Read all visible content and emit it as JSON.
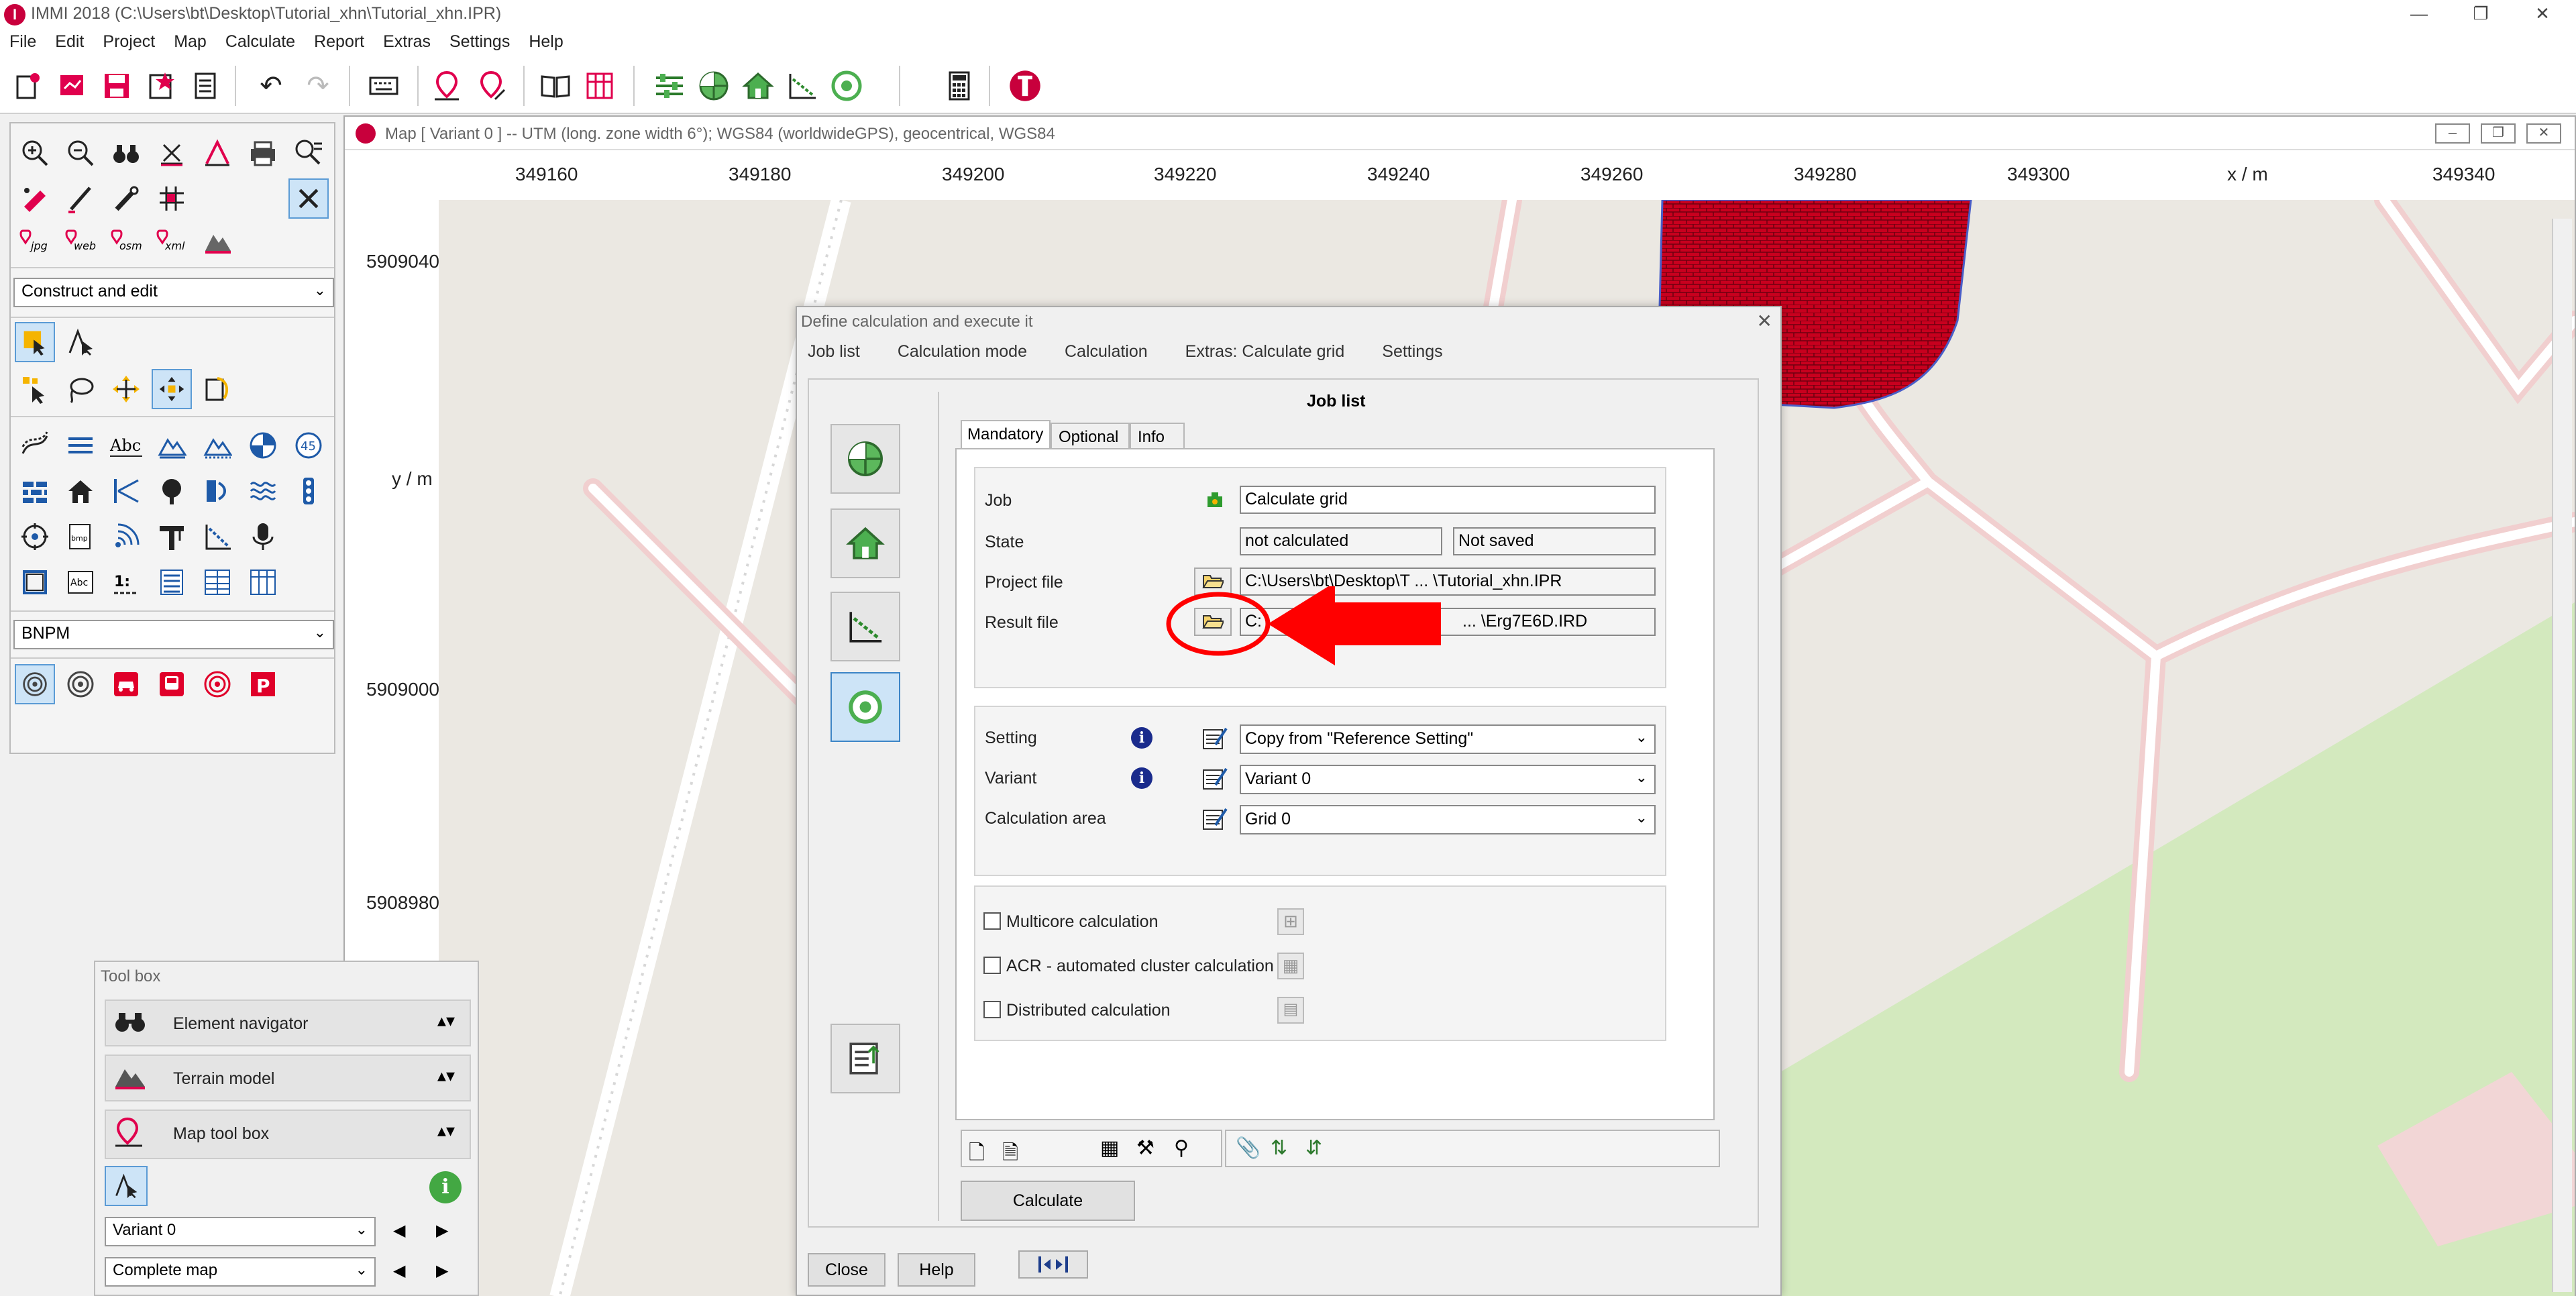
{
  "app": {
    "title": "IMMI 2018 (C:\\Users\\bt\\Desktop\\Tutorial_xhn\\Tutorial_xhn.IPR)",
    "logo_letter": "I"
  },
  "window_controls": {
    "minimize": "—",
    "restore": "❐",
    "close": "✕"
  },
  "menubar": [
    "File",
    "Edit",
    "Project",
    "Map",
    "Calculate",
    "Report",
    "Extras",
    "Settings",
    "Help"
  ],
  "left_panel": {
    "mode_select": "Construct and edit",
    "layer_select": "BNPM"
  },
  "map_window": {
    "title": "Map  [ Variant 0 ]  --  UTM (long. zone width 6°); WGS84 (worldwideGPS), geocentrical, WGS84",
    "x_ticks": [
      "349160",
      "349180",
      "349200",
      "349220",
      "349240",
      "349260",
      "349280",
      "349300",
      "x / m",
      "349340"
    ],
    "y_ticks": [
      "5909040",
      "y / m",
      "5909000",
      "5908980"
    ]
  },
  "dialog": {
    "title": "Define calculation and execute it",
    "menu": [
      "Job list",
      "Calculation mode",
      "Calculation",
      "Extras: Calculate grid",
      "Settings"
    ],
    "heading": "Job list",
    "tabs": [
      "Mandatory",
      "Optional",
      "Info"
    ],
    "fields": {
      "job_label": "Job",
      "job_value": "Calculate grid",
      "state_label": "State",
      "state_value1": "not calculated",
      "state_value2": "Not saved",
      "project_label": "Project file",
      "project_value": "C:\\Users\\bt\\Desktop\\T ... \\Tutorial_xhn.IPR",
      "result_label": "Result file",
      "result_value_start": "C:",
      "result_value_end": "... \\Erg7E6D.IRD"
    },
    "settings": {
      "setting_label": "Setting",
      "setting_value": "Copy from \"Reference Setting\"",
      "variant_label": "Variant",
      "variant_value": "Variant 0",
      "area_label": "Calculation area",
      "area_value": "Grid 0"
    },
    "options": {
      "multicore": "Multicore calculation",
      "acr": "ACR - automated cluster calculation",
      "distributed": "Distributed calculation"
    },
    "buttons": {
      "calculate": "Calculate",
      "close": "Close",
      "help": "Help"
    }
  },
  "toolbox": {
    "title": "Tool box",
    "items": [
      "Element navigator",
      "Terrain model",
      "Map tool box"
    ],
    "variant_select": "Variant 0",
    "map_select": "Complete map"
  },
  "colors": {
    "accent": "#e0004d",
    "annotation_red": "#ff0000",
    "building_red": "#c8001e",
    "green_area": "#d3e9be",
    "road": "#f5d8d8"
  }
}
